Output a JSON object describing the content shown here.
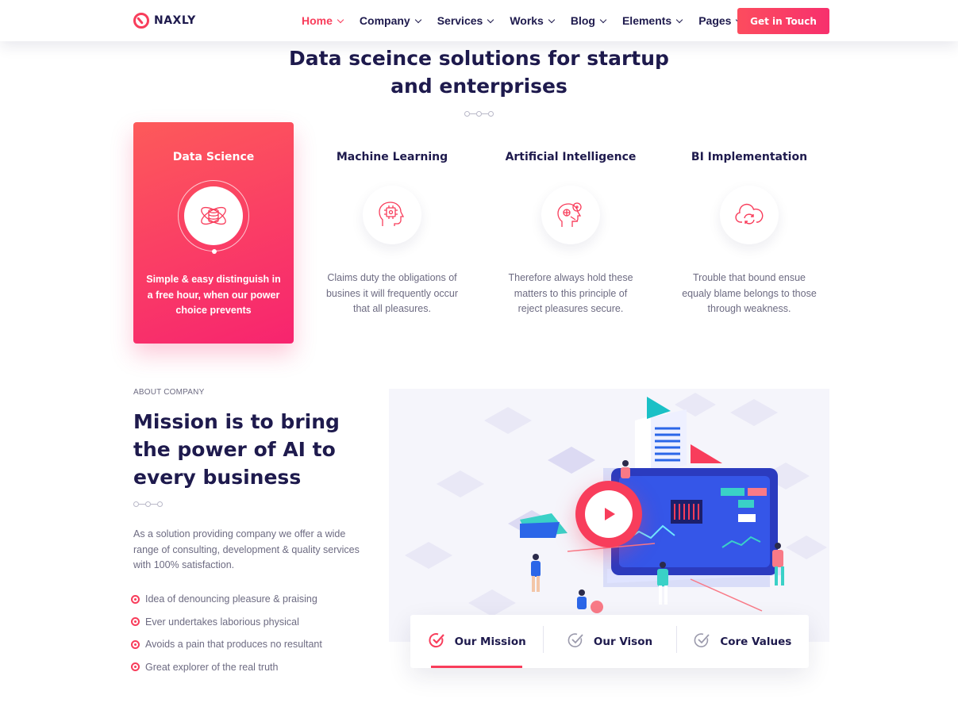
{
  "header": {
    "brand": "NAXLY",
    "nav": [
      {
        "label": "Home",
        "active": true
      },
      {
        "label": "Company",
        "active": false
      },
      {
        "label": "Services",
        "active": false
      },
      {
        "label": "Works",
        "active": false
      },
      {
        "label": "Blog",
        "active": false
      },
      {
        "label": "Elements",
        "active": false
      },
      {
        "label": "Pages",
        "active": false
      }
    ],
    "cta_label": "Get in Touch"
  },
  "services": {
    "title_line1": "Data sceince solutions for startup",
    "title_line2": "and enterprises",
    "cards": [
      {
        "title": "Data Science",
        "text": "Simple & easy distinguish in a free hour, when our power choice prevents",
        "icon": "data-science-icon",
        "active": true
      },
      {
        "title": "Machine Learning",
        "text": "Claims duty the obligations of busines it will frequently occur that all pleasures.",
        "icon": "machine-learning-icon",
        "active": false
      },
      {
        "title": "Artificial Intelligence",
        "text": "Therefore always hold these matters to this principle of reject pleasures secure.",
        "icon": "ai-icon",
        "active": false
      },
      {
        "title": "BI Implementation",
        "text": "Trouble that bound ensue equaly blame belongs to those through weakness.",
        "icon": "cloud-sync-icon",
        "active": false
      }
    ]
  },
  "about": {
    "eyebrow": "ABOUT COMPANY",
    "title_line1": "Mission is to bring",
    "title_line2": "the power of AI to",
    "title_line3": "every business",
    "text": "As a solution providing company we offer a wide range of consulting, development & quality services with 100% satisfaction.",
    "bullets": [
      "Idea of denouncing pleasure & praising",
      "Ever undertakes laborious physical",
      "Avoids a pain that produces no resultant",
      "Great explorer of the real truth"
    ]
  },
  "tabs": [
    {
      "label": "Our Mission",
      "active": true
    },
    {
      "label": "Our Vison",
      "active": false
    },
    {
      "label": "Core Values",
      "active": false
    }
  ],
  "colors": {
    "accent": "#f83d5b",
    "navy": "#1e1a4d",
    "muted": "#6d6b82"
  }
}
